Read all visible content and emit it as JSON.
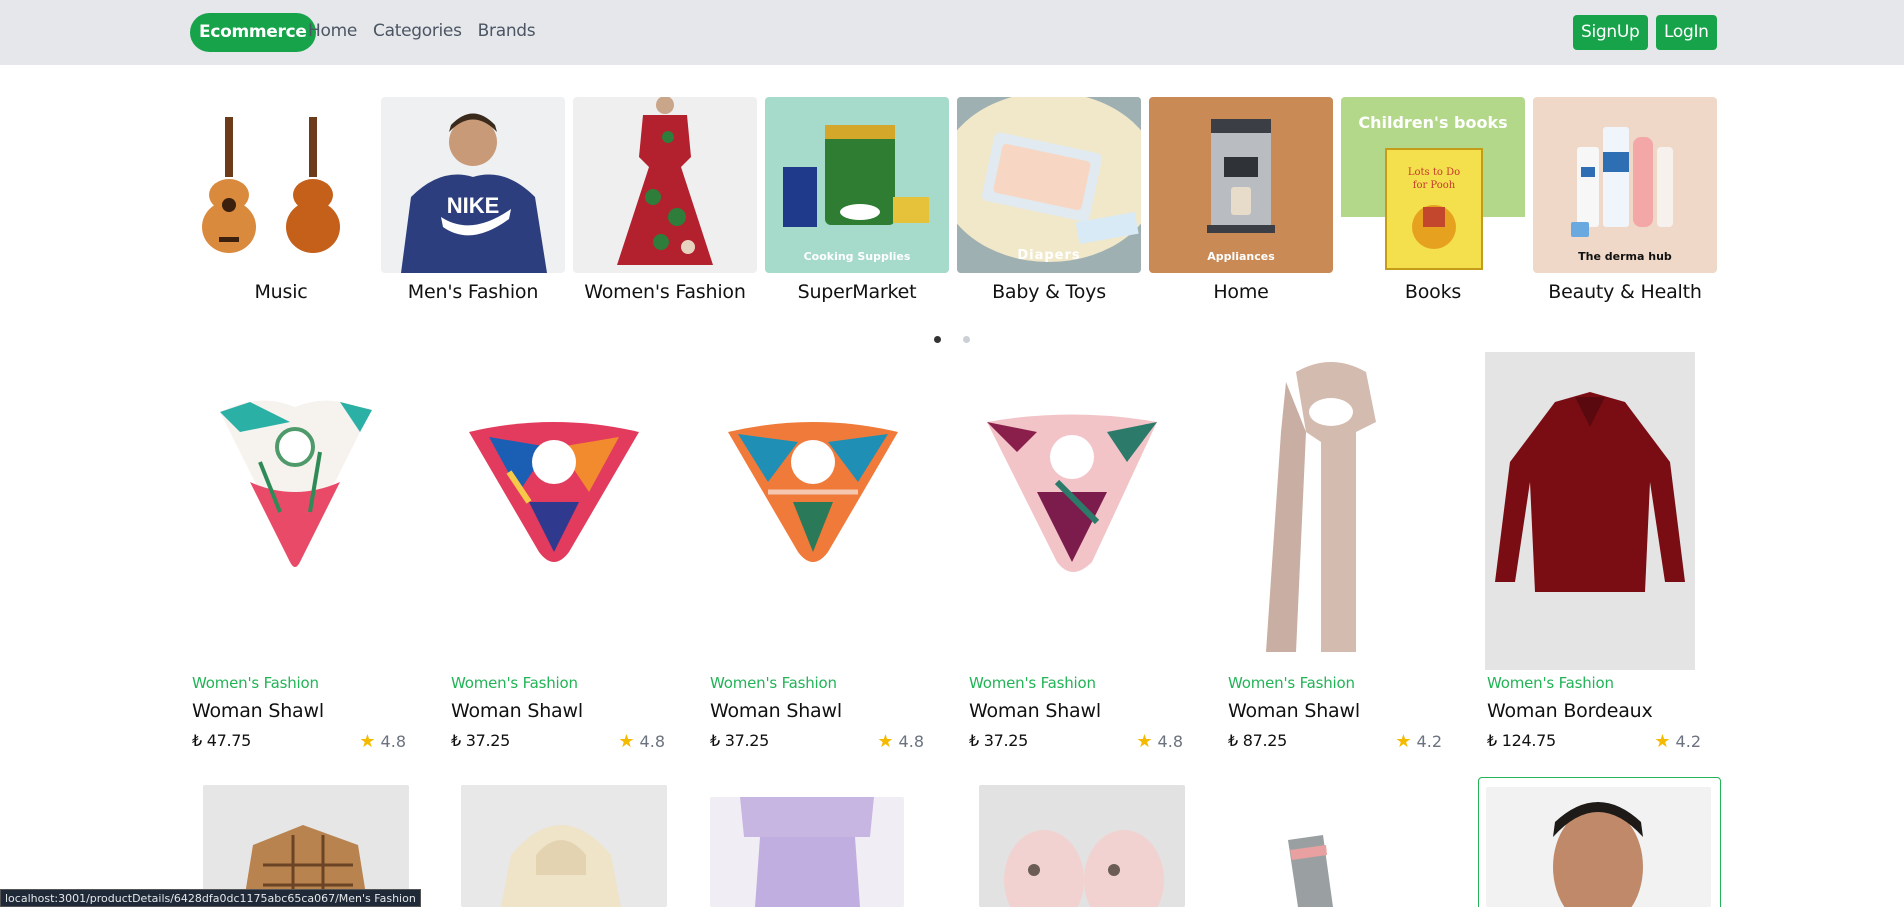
{
  "nav": {
    "brand": "Ecommerce",
    "links": [
      "Home",
      "Categories",
      "Brands"
    ],
    "signup": "SignUp",
    "login": "LogIn"
  },
  "categories": [
    {
      "name": "Music",
      "overlay": ""
    },
    {
      "name": "Men's Fashion",
      "overlay": ""
    },
    {
      "name": "Women's Fashion",
      "overlay": ""
    },
    {
      "name": "SuperMarket",
      "overlay": "Cooking Supplies"
    },
    {
      "name": "Baby & Toys",
      "overlay": "Diapers"
    },
    {
      "name": "Home",
      "overlay": "Appliances"
    },
    {
      "name": "Books",
      "overlay": "Children's books"
    },
    {
      "name": "Beauty & Health",
      "overlay": "The derma hub"
    }
  ],
  "products": [
    {
      "category": "Women's Fashion",
      "title": "Woman Shawl",
      "price": "47.75",
      "rating": "4.8"
    },
    {
      "category": "Women's Fashion",
      "title": "Woman Shawl",
      "price": "37.25",
      "rating": "4.8"
    },
    {
      "category": "Women's Fashion",
      "title": "Woman Shawl",
      "price": "37.25",
      "rating": "4.8"
    },
    {
      "category": "Women's Fashion",
      "title": "Woman Shawl",
      "price": "37.25",
      "rating": "4.8"
    },
    {
      "category": "Women's Fashion",
      "title": "Woman Shawl",
      "price": "87.25",
      "rating": "4.2"
    },
    {
      "category": "Women's Fashion",
      "title": "Woman Bordeaux",
      "price": "124.75",
      "rating": "4.2"
    }
  ],
  "currency_symbol": "₺",
  "status_url": "localhost:3001/productDetails/6428dfa0dc1175abc65ca067/Men's Fashion",
  "colors": {
    "accent": "#17a34a",
    "link_green": "#22b457",
    "star": "#f5b900"
  }
}
